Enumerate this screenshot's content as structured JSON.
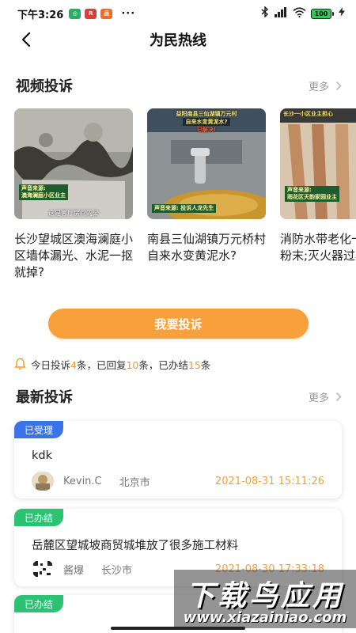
{
  "status_bar": {
    "time": "下午3:26",
    "app_icons": [
      {
        "name": "wechat-icon",
        "color": "#2aae67",
        "glyph": "◎"
      },
      {
        "name": "news-app-icon",
        "color": "#e23b3b",
        "glyph": "R"
      },
      {
        "name": "shop-app-icon",
        "color": "#ef6b2b",
        "glyph": "品"
      }
    ],
    "more": "···",
    "battery": "100"
  },
  "nav": {
    "title": "为民热线",
    "back_icon": "chevron-left-icon"
  },
  "video_section": {
    "title": "视频投诉",
    "more": "更多",
    "videos": [
      {
        "title": "长沙望城区澳海澜庭小区墙体漏光、水泥一抠就掉?",
        "tag_line1": "声音来源:",
        "tag_line2": "澳海澜庭小区业主",
        "caption": "这是客厅房间的梁"
      },
      {
        "title": "南县三仙湖镇万元桥村自来水变黄泥水?",
        "head_line1": "益阳南县三仙湖镇万元村",
        "head_line2": "自来水变黄泥水?",
        "head_line3": "已解决!",
        "tag_line1": "声音来源: 投诉人龙先生"
      },
      {
        "title": "消防水带老化一捏就成粉末;灭火器过期!",
        "head_line1": "长沙一小区业主担心",
        "tag_line1": "声音来源:",
        "tag_line2": "雨花区天韵家园业主"
      }
    ]
  },
  "complain_button": "我要投诉",
  "stats": {
    "prefix": "今日投诉",
    "today": "4",
    "unit1": "条，已回复",
    "replied": "10",
    "unit2": "条，已办结",
    "done": "15",
    "unit3": "条"
  },
  "latest_section": {
    "title": "最新投诉",
    "more": "更多",
    "items": [
      {
        "status": "已受理",
        "title": "kdk",
        "user": "Kevin.C",
        "city": "北京市",
        "time": "2021-08-31 15:11:26"
      },
      {
        "status": "已办结",
        "title": "岳麓区望城坡商贸城堆放了很多施工材料",
        "user": "酱爆",
        "city": "长沙市",
        "time": "2021-08-30 17:33:18"
      },
      {
        "status": "已办结"
      }
    ]
  },
  "colors": {
    "accent": "#f7a03c",
    "badge_accepted": "#3a72e8",
    "badge_done": "#2bc274",
    "time_text": "#f4a13e"
  },
  "watermark": {
    "main": "下载鸟应用",
    "sub": "www.xiazainiao.com"
  }
}
